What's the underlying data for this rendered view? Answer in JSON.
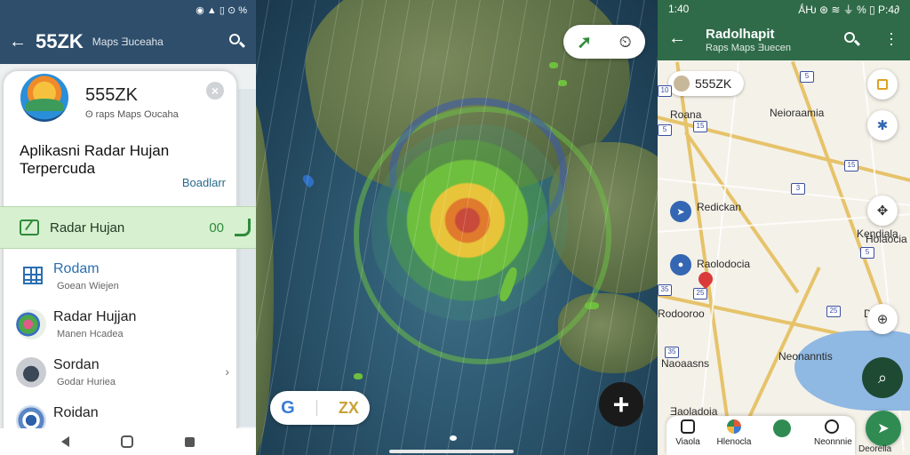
{
  "left": {
    "status_icons": "◉ ▲ ▯ ⊙ %",
    "appbar": {
      "back": "←",
      "title": "55ZK",
      "subtitle": "Maps Ǝuceaha"
    },
    "sheet": {
      "app_name": "555ZK",
      "app_sub": "ʘ raps Maps Oʊcaha",
      "description": "Aplikasni Radar Hujan Terpercuda",
      "more_link": "Boadlarr"
    },
    "active_row": {
      "label": "Radar Hujan",
      "value": "00"
    },
    "list": [
      {
        "title": "Rodam",
        "subtitle": "Goean Wiejen"
      },
      {
        "title": "Radar Hujjan",
        "subtitle": "Manen Hcadea"
      },
      {
        "title": "Sordan",
        "subtitle": "Godar Huriea"
      },
      {
        "title": "Roidan",
        "subtitle": ""
      }
    ]
  },
  "middle": {
    "top_pill": {
      "left_icon": "➚",
      "right_icon": "⏲"
    },
    "bottom_pill": {
      "g": "G",
      "x": "ZX"
    },
    "fab": "+"
  },
  "right": {
    "status": {
      "time": "1:40",
      "icons": "ǺǶ ⊛ ≋ ⏚ %  ▯ P:4∂"
    },
    "appbar": {
      "back": "←",
      "title": "Radolhapit",
      "subtitle": "Raps Maps Ǝuecen"
    },
    "chip": "555ZK",
    "labels": [
      "Roana",
      "Neioraamia",
      "Redickan",
      "Raolodocia",
      "Kendiala",
      "Neonanntis",
      "Naoaasns",
      "Ǝaoladoia",
      "Hoiaocia",
      "Rodooroo",
      "D"
    ],
    "shields": [
      "5",
      "15",
      "3",
      "15",
      "5",
      "25",
      "35",
      "25",
      "5",
      "10",
      "35"
    ],
    "bottom_nav": [
      "Viaola",
      "Hlenocla",
      "",
      "Neonnnie",
      "Deorella"
    ]
  }
}
